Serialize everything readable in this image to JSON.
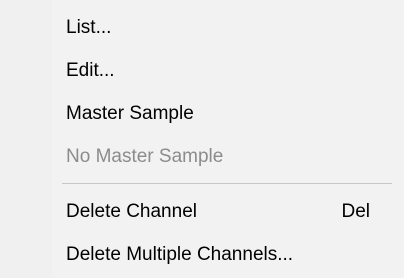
{
  "menu": {
    "items": [
      {
        "label": "List...",
        "enabled": true,
        "shortcut": ""
      },
      {
        "label": "Edit...",
        "enabled": true,
        "shortcut": ""
      },
      {
        "label": "Master Sample",
        "enabled": true,
        "shortcut": ""
      },
      {
        "label": "No Master Sample",
        "enabled": false,
        "shortcut": ""
      },
      {
        "label": "Delete Channel",
        "enabled": true,
        "shortcut": "Del"
      },
      {
        "label": "Delete Multiple Channels...",
        "enabled": true,
        "shortcut": ""
      }
    ],
    "colors": {
      "background": "#f2f2f2",
      "text": "#000000",
      "disabled_text": "#8c8c8c",
      "separator": "#c8c8c8"
    }
  }
}
